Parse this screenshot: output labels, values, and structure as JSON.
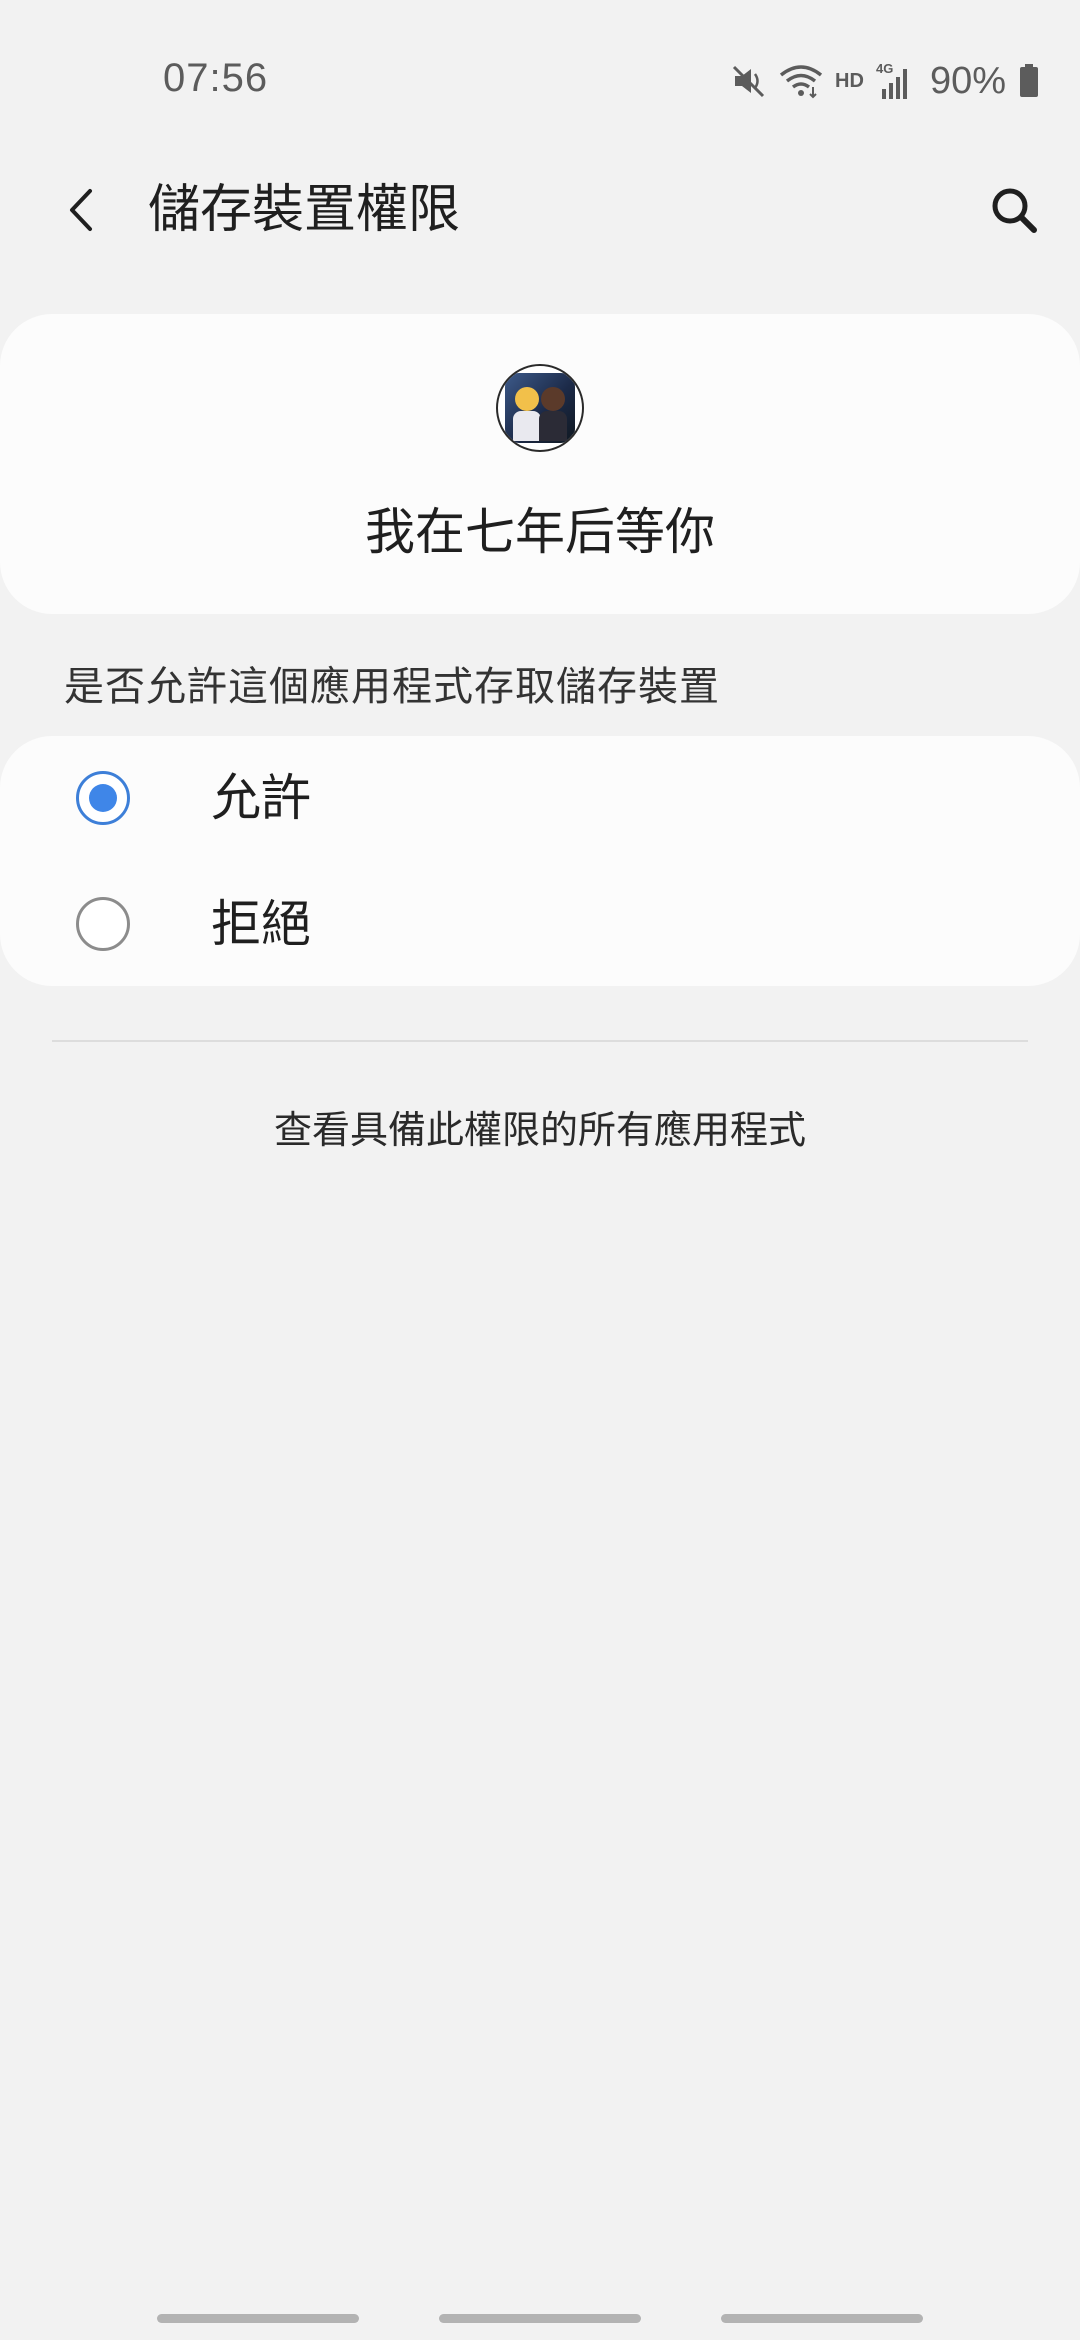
{
  "status_bar": {
    "time": "07:56",
    "icons": [
      "mute-icon",
      "wifi-icon",
      "hd-icon",
      "signal-4g-icon",
      "battery-icon"
    ],
    "hd_label": "HD",
    "network_label": "4G",
    "battery_percent": "90%"
  },
  "app_bar": {
    "title": "儲存裝置權限",
    "back_icon": "back-arrow-icon",
    "search_icon": "search-icon"
  },
  "app_info": {
    "name": "我在七年后等你",
    "icon": "app-icon"
  },
  "permission": {
    "question": "是否允許這個應用程式存取儲存裝置",
    "options": [
      {
        "label": "允許",
        "selected": true
      },
      {
        "label": "拒絕",
        "selected": false
      }
    ]
  },
  "footer_link": "查看具備此權限的所有應用程式",
  "colors": {
    "background": "#f2f2f2",
    "card": "#fcfcfc",
    "radio_selected": "#3f86e8",
    "radio_unselected": "#8c8c8c"
  }
}
